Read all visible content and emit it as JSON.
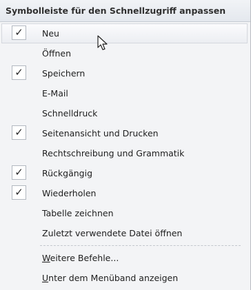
{
  "menu": {
    "title": "Symbolleiste für den Schnellzugriff anpassen",
    "items": [
      {
        "label": "Neu",
        "checked": true,
        "hover": true
      },
      {
        "label": "Öffnen",
        "checked": false
      },
      {
        "label": "Speichern",
        "checked": true
      },
      {
        "label": "E-Mail",
        "checked": false
      },
      {
        "label": "Schnelldruck",
        "checked": false
      },
      {
        "label": "Seitenansicht und Drucken",
        "checked": true
      },
      {
        "label": "Rechtschreibung und Grammatik",
        "checked": false
      },
      {
        "label": "Rückgängig",
        "checked": true
      },
      {
        "label": "Wiederholen",
        "checked": true
      },
      {
        "label": "Tabelle zeichnen",
        "checked": false
      },
      {
        "label": "Zuletzt verwendete Datei öffnen",
        "checked": false
      }
    ],
    "more_commands": {
      "accel": "W",
      "rest": "eitere Befehle..."
    },
    "below_ribbon": {
      "accel": "U",
      "rest": "nter dem Menüband anzeigen"
    },
    "check_glyph": "✓"
  }
}
